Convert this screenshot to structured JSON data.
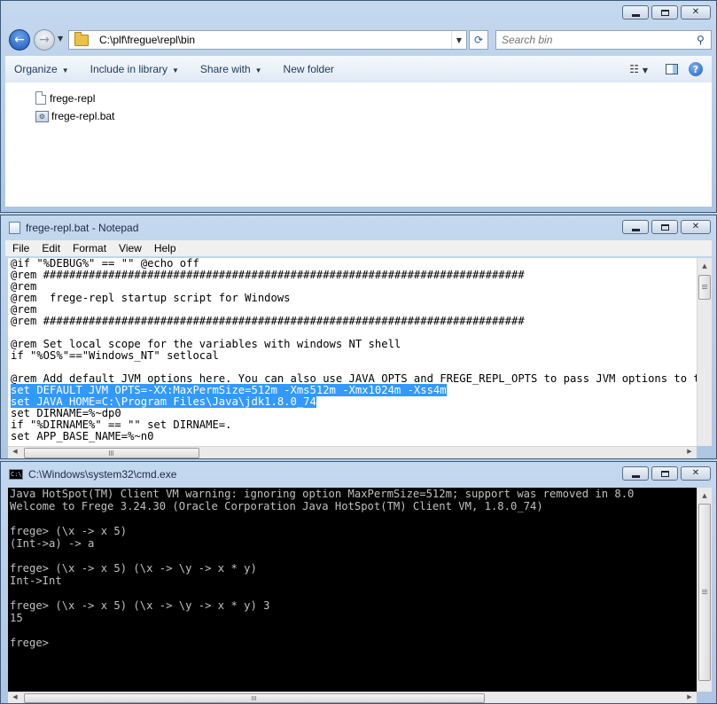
{
  "explorer": {
    "address": "C:\\plf\\fregue\\repl\\bin",
    "search_placeholder": "Search bin",
    "toolbar": {
      "organize": "Organize",
      "include": "Include in library",
      "share": "Share with",
      "new_folder": "New folder"
    },
    "files": [
      {
        "name": "frege-repl",
        "icon": "file-icon"
      },
      {
        "name": "frege-repl.bat",
        "icon": "batch-file-icon"
      }
    ]
  },
  "notepad": {
    "title": "frege-repl.bat - Notepad",
    "menu": [
      "File",
      "Edit",
      "Format",
      "View",
      "Help"
    ],
    "lines": [
      "@if \"%DEBUG%\" == \"\" @echo off",
      "@rem ##########################################################################",
      "@rem",
      "@rem  frege-repl startup script for Windows",
      "@rem",
      "@rem ##########################################################################",
      "",
      "@rem Set local scope for the variables with windows NT shell",
      "if \"%OS%\"==\"Windows_NT\" setlocal",
      "",
      "@rem Add default JVM options here. You can also use JAVA_OPTS and FREGE_REPL_OPTS to pass JVM options to this script.",
      "set DEFAULT_JVM_OPTS=-XX:MaxPermSize=512m -Xms512m -Xmx1024m -Xss4m",
      "set JAVA_HOME=C:\\Program Files\\Java\\jdk1.8.0_74",
      "set DIRNAME=%~dp0",
      "if \"%DIRNAME%\" == \"\" set DIRNAME=.",
      "set APP_BASE_NAME=%~n0"
    ],
    "selected_lines": [
      11,
      12
    ]
  },
  "cmd": {
    "title": "C:\\Windows\\system32\\cmd.exe",
    "lines": [
      "Java HotSpot(TM) Client VM warning: ignoring option MaxPermSize=512m; support was removed in 8.0",
      "Welcome to Frege 3.24.30 (Oracle Corporation Java HotSpot(TM) Client VM, 1.8.0_74)",
      "",
      "frege> (\\x -> x 5)",
      "(Int->a) -> a",
      "",
      "frege> (\\x -> x 5) (\\x -> \\y -> x * y)",
      "Int->Int",
      "",
      "frege> (\\x -> x 5) (\\x -> \\y -> x * y) 3",
      "15",
      "",
      "frege>"
    ]
  },
  "colors": {
    "selection": "#3399ff",
    "console_bg": "#000000",
    "console_text": "#c0c0c0"
  }
}
